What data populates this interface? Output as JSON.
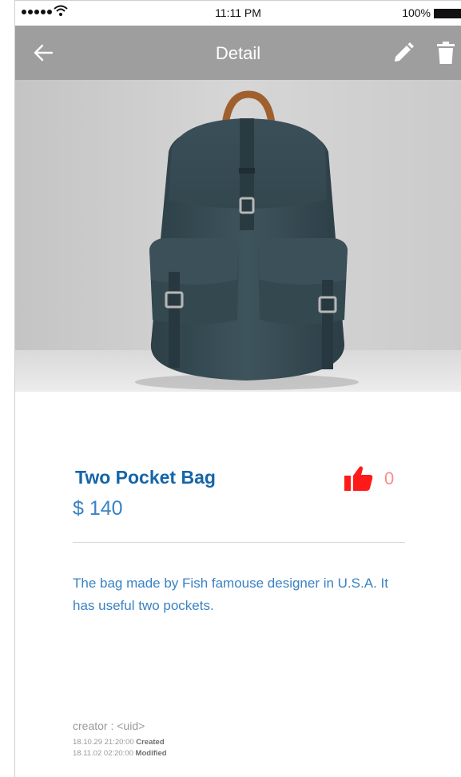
{
  "status_bar": {
    "time": "11:11 PM",
    "battery": "100%"
  },
  "app_bar": {
    "title": "Detail",
    "icons": [
      "back-arrow-icon",
      "edit-pencil-icon",
      "trash-icon"
    ]
  },
  "product": {
    "name": "Two Pocket Bag",
    "price": "$ 140",
    "likes": "0",
    "description": "The bag made by Fish famouse designer in U.S.A. It has useful two pockets."
  },
  "meta": {
    "creator": "creator : <uid>",
    "created_date": "18.10.29 21:20:00",
    "created_label": "Created",
    "modified_date": "18.11.02 02:20:00",
    "modified_label": "Modified"
  },
  "colors": {
    "app_bar": "#9e9e9e",
    "title_blue": "#1565a8",
    "text_blue": "#3a82c4",
    "like_red": "#ff1a1a"
  }
}
